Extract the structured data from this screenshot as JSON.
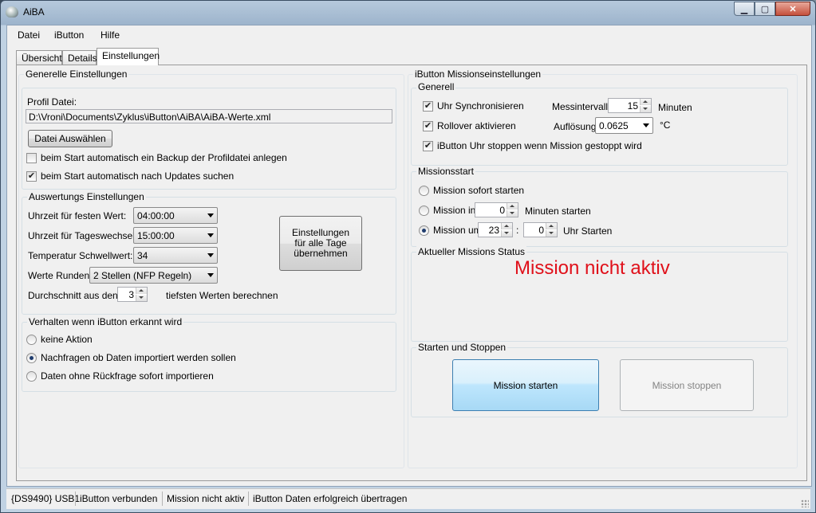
{
  "window": {
    "title": "AiBA"
  },
  "menu": [
    "Datei",
    "iButton",
    "Hilfe"
  ],
  "tabs": [
    "Übersicht",
    "Details",
    "Einstellungen"
  ],
  "general": {
    "group_label": "Generelle Einstellungen",
    "profile_label": "Profil Datei:",
    "profile_path": "D:\\Vroni\\Documents\\Zyklus\\iButton\\AiBA\\AiBA-Werte.xml",
    "choose_button": "Datei Auswählen",
    "backup_label": "beim Start automatisch ein Backup der Profildatei anlegen",
    "backup_checked": false,
    "updates_label": "beim Start automatisch nach Updates suchen",
    "updates_checked": true
  },
  "evaluation": {
    "group_label": "Auswertungs Einstellungen",
    "fixed_time_label": "Uhrzeit für festen Wert:",
    "fixed_time_value": "04:00:00",
    "day_change_label": "Uhrzeit für Tageswechsel:",
    "day_change_value": "15:00:00",
    "threshold_label": "Temperatur Schwellwert:",
    "threshold_value": "34",
    "round_label": "Werte Runden:",
    "round_value": "2 Stellen (NFP Regeln)",
    "avg_prefix": "Durchschnitt aus den",
    "avg_value": "3",
    "avg_suffix": "tiefsten Werten berechnen",
    "apply_all_button": "Einstellungen für alle Tage übernehmen"
  },
  "detect": {
    "group_label": "Verhalten wenn iButton erkannt wird",
    "options": [
      {
        "label": "keine Aktion",
        "selected": false
      },
      {
        "label": "Nachfragen ob Daten importiert werden sollen",
        "selected": true
      },
      {
        "label": "Daten ohne Rückfrage sofort importieren",
        "selected": false
      }
    ]
  },
  "mission": {
    "group_label": "iButton Missionseinstellungen",
    "general_label": "Generell",
    "sync_label": "Uhr Synchronisieren",
    "sync_checked": true,
    "rollover_label": "Rollover aktivieren",
    "rollover_checked": true,
    "stop_clock_label": "iButton Uhr stoppen wenn Mission gestoppt wird",
    "stop_clock_checked": true,
    "interval_label": "Messintervall",
    "interval_value": "15",
    "interval_unit": "Minuten",
    "resolution_label": "Auflösung",
    "resolution_value": "0.0625",
    "resolution_unit": "°C"
  },
  "mission_start": {
    "group_label": "Missionsstart",
    "now_label": "Mission sofort starten",
    "in_label": "Mission in",
    "in_value": "0",
    "in_suffix": "Minuten starten",
    "at_label": "Mission um",
    "at_hour": "23",
    "at_sep": ":",
    "at_minute": "0",
    "at_suffix": "Uhr Starten",
    "selected": "at"
  },
  "mission_status": {
    "group_label": "Aktueller Missions Status",
    "status_text": "Mission nicht aktiv",
    "status_color": "#e0101a"
  },
  "start_stop": {
    "group_label": "Starten und Stoppen",
    "start_button": "Mission starten",
    "stop_button": "Mission stoppen"
  },
  "statusbar": [
    "{DS9490} USB1",
    "iButton verbunden",
    "Mission nicht aktiv",
    "iButton Daten erfolgreich übertragen"
  ]
}
